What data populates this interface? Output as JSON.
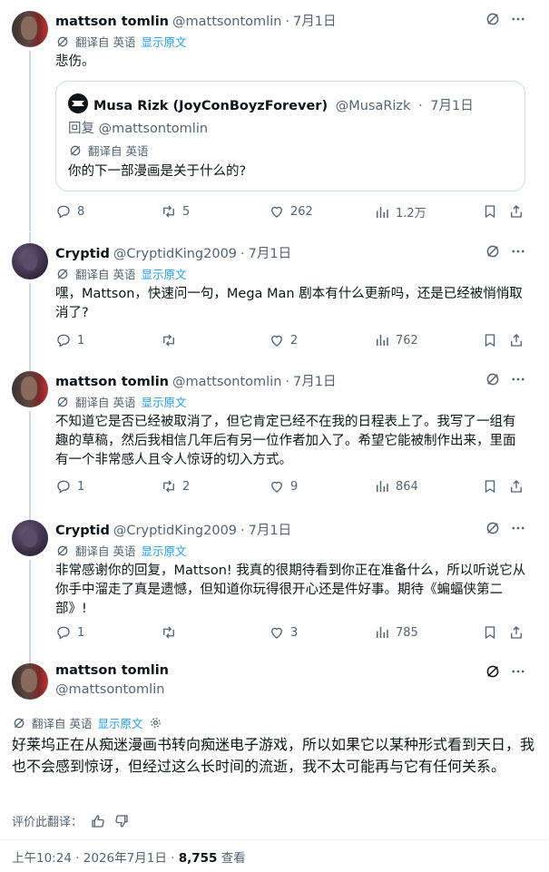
{
  "tweets": [
    {
      "name": "mattson tomlin",
      "handle": "@mattsontomlin",
      "date": "7月1日",
      "translate_label": "翻译自 英语",
      "show_original": "显示原文",
      "text": "悲伤。",
      "quote": {
        "name": "Musa Rizk (JoyConBoyzForever)",
        "handle": "@MusaRizk",
        "date": "7月1日",
        "reply_to": "回复 @mattsontomlin",
        "translate_label": "翻译自 英语",
        "text": "你的下一部漫画是关于什么的?"
      },
      "replies": "8",
      "retweets": "5",
      "likes": "262",
      "views": "1.2万"
    },
    {
      "name": "Cryptid",
      "handle": "@CryptidKing2009",
      "date": "7月1日",
      "translate_label": "翻译自 英语",
      "show_original": "显示原文",
      "text": "嘿，Mattson，快速问一句，Mega Man 剧本有什么更新吗，还是已经被悄悄取消了?",
      "replies": "1",
      "retweets": "",
      "likes": "2",
      "views": "762"
    },
    {
      "name": "mattson tomlin",
      "handle": "@mattsontomlin",
      "date": "7月1日",
      "translate_label": "翻译自 英语",
      "show_original": "显示原文",
      "text": "不知道它是否已经被取消了，但它肯定已经不在我的日程表上了。我写了一组有趣的草稿，然后我相信几年后有另一位作者加入了。希望它能被制作出来，里面有一个非常感人且令人惊讶的切入方式。",
      "replies": "1",
      "retweets": "2",
      "likes": "9",
      "views": "864"
    },
    {
      "name": "Cryptid",
      "handle": "@CryptidKing2009",
      "date": "7月1日",
      "translate_label": "翻译自 英语",
      "show_original": "显示原文",
      "text": "非常感谢你的回复，Mattson! 我真的很期待看到你正在准备什么，所以听说它从你手中溜走了真是遗憾，但知道你玩得很开心还是件好事。期待《蝙蝠侠第二部》!",
      "replies": "1",
      "retweets": "",
      "likes": "3",
      "views": "785"
    }
  ],
  "focal": {
    "name": "mattson tomlin",
    "handle": "@mattsontomlin",
    "translate_label": "翻译自 英语",
    "show_original": "显示原文",
    "text": "好莱坞正在从痴迷漫画书转向痴迷电子游戏，所以如果它以某种形式看到天日，我也不会感到惊讶，但经过这么长时间的流逝，我不太可能再与它有任何关系。",
    "rate_label": "评价此翻译：",
    "time": "上午10:24 · 2026年7月1日 · ",
    "views": "8,755",
    "views_label": " 查看"
  },
  "colors": {
    "accent": "#1d9bf0",
    "text": "#0f1419",
    "secondary": "#536471",
    "border": "#cfd9de"
  },
  "icons": [
    "grok-icon",
    "more-icon",
    "translate-icon",
    "reply-icon",
    "retweet-icon",
    "like-icon",
    "views-icon",
    "bookmark-icon",
    "share-icon",
    "gear-icon",
    "thumbs-up-icon",
    "thumbs-down-icon"
  ]
}
